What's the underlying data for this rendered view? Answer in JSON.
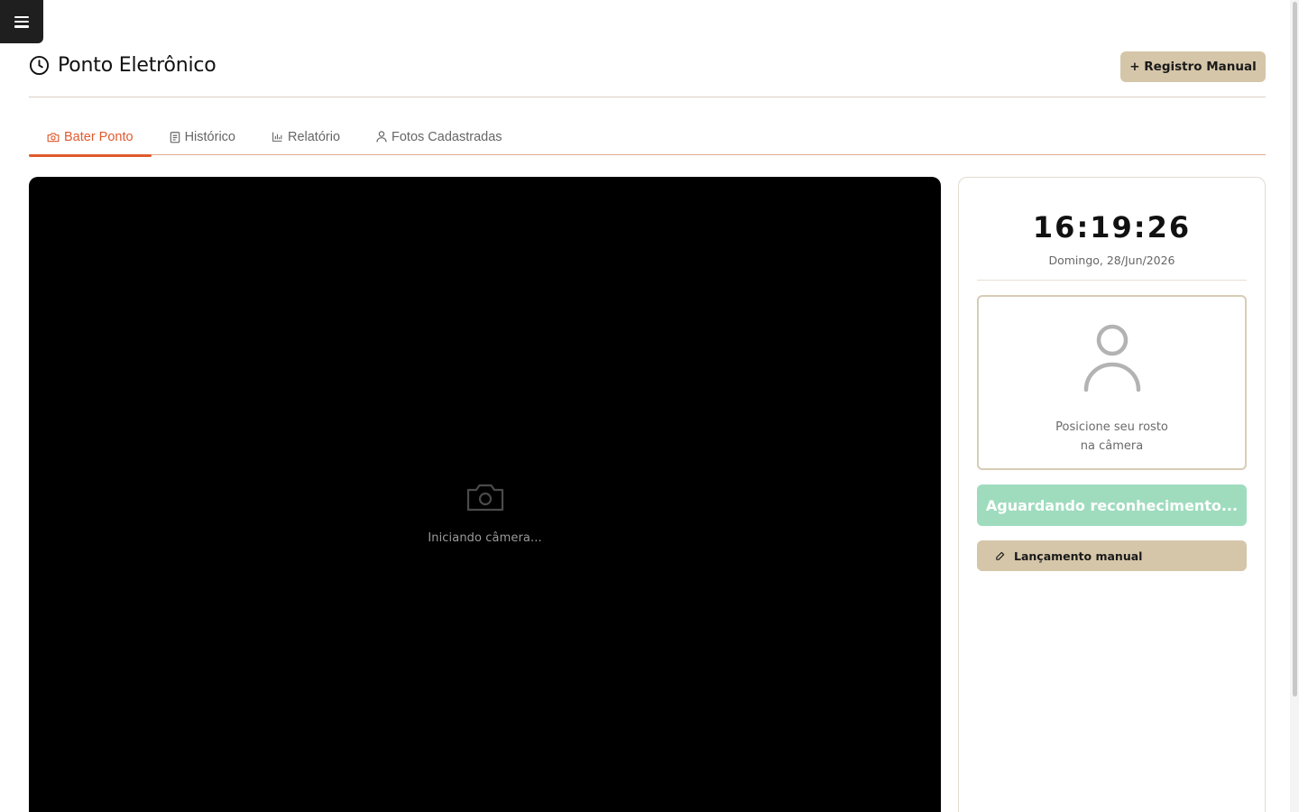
{
  "nav": {
    "menu_icon": "hamburger-menu-icon"
  },
  "header": {
    "title": "Ponto Eletrônico",
    "title_icon": "clock-icon",
    "manual_button_label": "+ Registro Manual"
  },
  "tabs": [
    {
      "label": "Bater Ponto",
      "icon": "camera-icon",
      "active": true
    },
    {
      "label": "Histórico",
      "icon": "clipboard-icon",
      "active": false
    },
    {
      "label": "Relatório",
      "icon": "bar-chart-icon",
      "active": false
    },
    {
      "label": "Fotos Cadastradas",
      "icon": "user-icon",
      "active": false
    }
  ],
  "camera": {
    "icon": "camera-icon",
    "status_text": "Iniciando câmera..."
  },
  "side_panel": {
    "time": "16:19:26",
    "date": "Domingo, 28/Jun/2026",
    "face_icon": "person-icon",
    "face_hint_line1": "Posicione seu rosto",
    "face_hint_line2": "na câmera",
    "status_button_label": "Aguardando reconhecimento...",
    "launch_button_label": "Lançamento manual",
    "launch_button_icon": "pencil-icon"
  },
  "colors": {
    "accent": "#e05a2c",
    "beige_button": "#d5c6a9",
    "status_green": "#9fdcbe",
    "camera_bg": "#000000"
  }
}
